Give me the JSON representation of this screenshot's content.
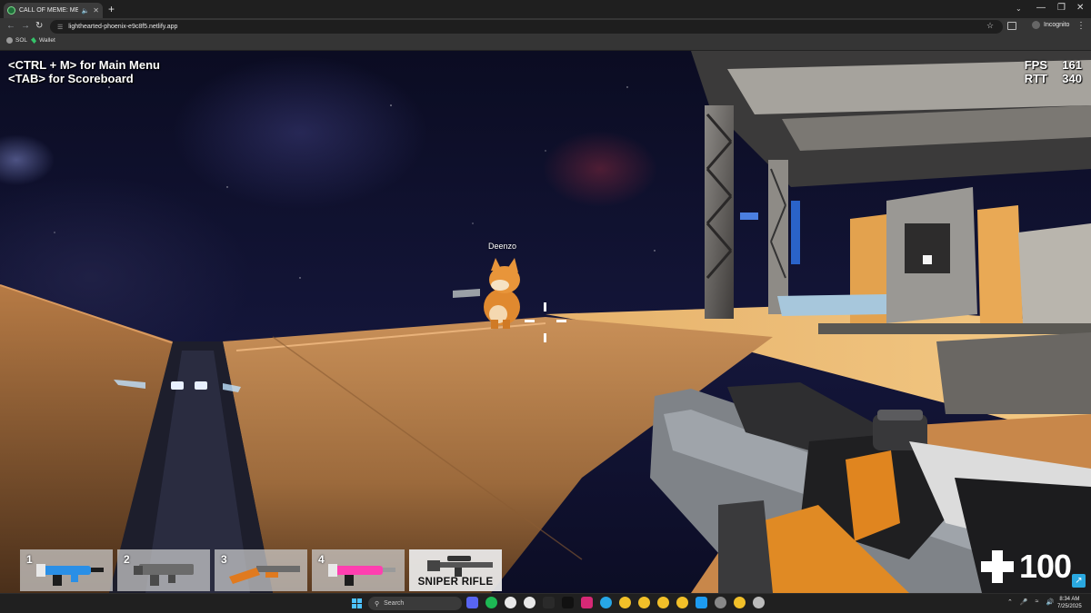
{
  "browser": {
    "tab_title": "CALL OF MEME: MEME OPS",
    "url": "lighthearted-phoenix-e9c8f5.netlify.app",
    "incognito_label": "Incognito",
    "bookmarks": [
      "SOL",
      "Wallet"
    ]
  },
  "hud": {
    "help_lines": [
      "<CTRL + M> for Main Menu",
      "<TAB> for Scoreboard"
    ],
    "stats": [
      {
        "label": "FPS",
        "value": "161"
      },
      {
        "label": "RTT",
        "value": "340"
      }
    ],
    "player_name": "Deenzo",
    "health": "100",
    "weapon_slots": [
      {
        "number": "1",
        "icon": "blue-blaster-icon",
        "color": "#2a8fe6"
      },
      {
        "number": "2",
        "icon": "gray-assault-rifle-icon",
        "color": "#6b6b6b"
      },
      {
        "number": "3",
        "icon": "orange-shotgun-icon",
        "color": "#e07a1f"
      },
      {
        "number": "4",
        "icon": "pink-blaster-icon",
        "color": "#ff3fb0"
      },
      {
        "number": "",
        "icon": "sniper-rifle-icon",
        "label": "SNIPER RIFLE",
        "active": true,
        "color": "#555555"
      }
    ]
  },
  "taskbar": {
    "search_placeholder": "Search",
    "time": "8:34 AM",
    "date": "7/25/2025"
  }
}
